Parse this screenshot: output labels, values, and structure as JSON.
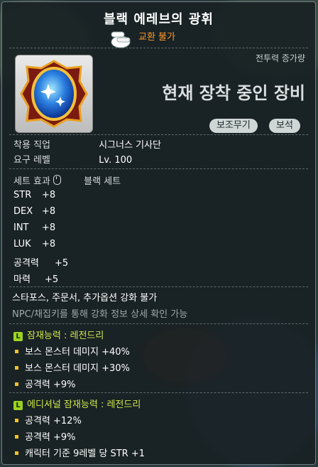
{
  "tooltip": {
    "title": "블랙 에레브의 광휘",
    "trade_status": "교환 불가",
    "combat_power_label": "전투력 증가량",
    "equipped_text": "현재 장착 중인 장비",
    "tags": [
      "보조무기",
      "보석"
    ],
    "job_label": "착용 직업",
    "job_value": "시그너스 기사단",
    "level_label": "요구 레벨",
    "level_value": "Lv. 100",
    "set_label": "세트 효과",
    "set_name": "블랙 세트",
    "stats": [
      {
        "name": "STR",
        "value": "+8"
      },
      {
        "name": "DEX",
        "value": "+8"
      },
      {
        "name": "INT",
        "value": "+8"
      },
      {
        "name": "LUK",
        "value": "+8"
      },
      {
        "name": "공격력",
        "value": "+5"
      },
      {
        "name": "마력",
        "value": "+5"
      }
    ],
    "enhance_note": "스타포스, 주문서, 추가옵션 강화 불가",
    "npc_note": "NPC/채집키를 통해 강화 정보 상세 확인 가능",
    "potential": {
      "badge": "L",
      "header": "잠재능력 : 레전드리",
      "lines": [
        "보스 몬스터 데미지 +40%",
        "보스 몬스터 데미지 +30%",
        "공격력 +9%"
      ]
    },
    "additional_potential": {
      "badge": "L",
      "header": "에디셔널 잠재능력 : 레전드리",
      "lines": [
        "공격력 +12%",
        "공격력 +9%",
        "캐릭터 기준 9레벨 당 STR +1"
      ]
    },
    "colors": {
      "trade": "#ff9a2e",
      "potential_header": "#cfe84d",
      "badge": "#9cd322",
      "bullet": "#f2c226"
    }
  }
}
